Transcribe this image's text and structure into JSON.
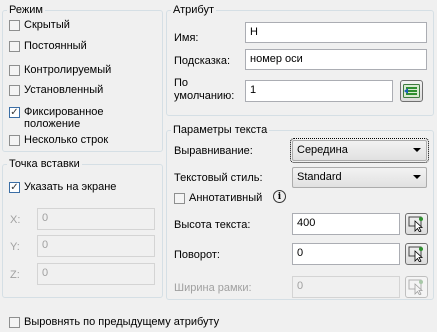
{
  "mode": {
    "title": "Режим",
    "options": [
      {
        "label": "Скрытый",
        "checked": false
      },
      {
        "label": "Постоянный",
        "checked": false
      },
      {
        "label": "Контролируемый",
        "checked": false
      },
      {
        "label": "Установленный",
        "checked": false
      },
      {
        "label": "Фиксированное положение",
        "label_line1": "Фиксированное",
        "label_line2": "положение",
        "checked": true
      },
      {
        "label": "Несколько строк",
        "checked": false
      }
    ]
  },
  "insertion_point": {
    "title": "Точка вставки",
    "specify_on_screen": {
      "label": "Указать на экране",
      "checked": true
    },
    "x_label": "X:",
    "y_label": "Y:",
    "z_label": "Z:",
    "x_value": "0",
    "y_value": "0",
    "z_value": "0"
  },
  "attribute": {
    "title": "Атрибут",
    "name_label": "Имя:",
    "name_value": "Н",
    "prompt_label": "Подсказка:",
    "prompt_value": "номер оси",
    "default_label_line1": "По",
    "default_label_line2": "умолчанию:",
    "default_value": "1",
    "insert_field_icon": "insert-field-icon"
  },
  "text_settings": {
    "title": "Параметры текста",
    "justification_label": "Выравнивание:",
    "justification_value": "Середина",
    "text_style_label": "Текстовый стиль:",
    "text_style_value": "Standard",
    "annotative_label": "Аннотативный",
    "annotative_checked": false,
    "text_height_label": "Высота текста:",
    "text_height_value": "400",
    "rotation_label": "Поворот:",
    "rotation_value": "0",
    "boundary_width_label": "Ширина рамки:",
    "boundary_width_value": "0"
  },
  "align_below_previous": {
    "label": "Выровнять по предыдущему атрибуту",
    "checked": false
  }
}
